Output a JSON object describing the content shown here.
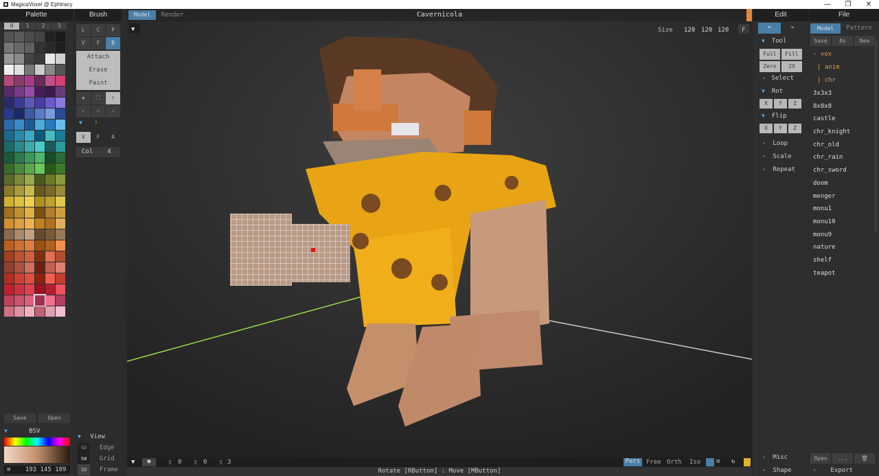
{
  "window": {
    "title": "MagicaVoxel @ Ephtracy",
    "controls": [
      "—",
      "❐",
      "✕"
    ]
  },
  "palette": {
    "header": "Palette",
    "tabs": [
      "0",
      "1",
      "2",
      "3"
    ],
    "colors": [
      "#555",
      "#5a5a5a",
      "#4c4c4c",
      "#444",
      "#222",
      "#1a1a1a",
      "#777",
      "#6a6a6a",
      "#5f5f5f",
      "#333",
      "#2a2a2a",
      "#1e1e1e",
      "#999",
      "#8a8a8a",
      "#444",
      "#3a3a3a",
      "#e8e8e8",
      "#cfcfcf",
      "#f0f0f0",
      "#e0e0e0",
      "#777",
      "#ccc",
      "#888",
      "#555",
      "#b34a7a",
      "#8c3a6a",
      "#a53a8a",
      "#6a2a5a",
      "#c0508a",
      "#d04070",
      "#5a2a6a",
      "#7a3a8a",
      "#9a4aaa",
      "#4a1a5a",
      "#3a1a4a",
      "#6a3a7a",
      "#2a2a6a",
      "#3a3a9a",
      "#5a5aba",
      "#4a3aaa",
      "#6a5aca",
      "#8a7ada",
      "#2a3a8a",
      "#1a2a6a",
      "#3a5aaa",
      "#5a7aca",
      "#7a9ada",
      "#2a4a9a",
      "#2a6aaa",
      "#3a8aca",
      "#1a5a9a",
      "#4aaada",
      "#2a7aba",
      "#6abaea",
      "#1a6a8a",
      "#2a8aaa",
      "#3aaaca",
      "#0a5a7a",
      "#4ababa",
      "#1a7a9a",
      "#1a6a6a",
      "#2a8a8a",
      "#3aaaaa",
      "#4acaca",
      "#1a5a5a",
      "#2a9a9a",
      "#1a5a3a",
      "#2a7a4a",
      "#3a9a5a",
      "#4aba6a",
      "#1a4a2a",
      "#2a6a3a",
      "#3a6a2a",
      "#4a8a3a",
      "#5aaa4a",
      "#6aca5a",
      "#2a5a1a",
      "#3a7a2a",
      "#5a6a2a",
      "#7a8a3a",
      "#9aaa4a",
      "#4a5a1a",
      "#6a7a2a",
      "#8a9a3a",
      "#8a7a2a",
      "#aa9a3a",
      "#caba4a",
      "#6a5a1a",
      "#7a6a2a",
      "#9a8a3a",
      "#d0b030",
      "#e0c040",
      "#f0d050",
      "#b09020",
      "#c0a030",
      "#e0c850",
      "#a07020",
      "#c09030",
      "#e0b040",
      "#805010",
      "#b08030",
      "#d0a040",
      "#d09030",
      "#e0a040",
      "#f0b050",
      "#c08020",
      "#b07020",
      "#e0b060",
      "#8a6a4a",
      "#aa8a6a",
      "#c4a080",
      "#6a4a2a",
      "#7a5a3a",
      "#9a7a5a",
      "#c06020",
      "#d07030",
      "#e08040",
      "#a05010",
      "#b06020",
      "#f09050",
      "#a04020",
      "#c05030",
      "#d06040",
      "#803010",
      "#e07050",
      "#b05030",
      "#904030",
      "#b05040",
      "#d07060",
      "#702010",
      "#c06050",
      "#e08070",
      "#b03020",
      "#d04030",
      "#e05040",
      "#902010",
      "#f06050",
      "#c04030",
      "#c02030",
      "#d03040",
      "#e04050",
      "#a01020",
      "#b02030",
      "#f05060",
      "#c04060",
      "#d05070",
      "#e06080",
      "#a03050",
      "#f07090",
      "#b04060",
      "#d07080",
      "#e090a0",
      "#f0b0c0",
      "#c06070",
      "#e0a0b0",
      "#f0c0d0"
    ],
    "save_label": "Save",
    "open_label": "Open",
    "mode_label": "BSV",
    "rgb_value": "193 145 109"
  },
  "brush": {
    "header": "Brush",
    "shape_row1": [
      "L",
      "C",
      "P"
    ],
    "shape_row2": [
      "V",
      "F",
      "B"
    ],
    "modes": [
      "Attach",
      "Erase",
      "Paint"
    ],
    "axis_row": [
      "V",
      "F",
      "A"
    ],
    "col_label": "Col",
    "col_value": "4"
  },
  "viewport": {
    "tabs": [
      "Model",
      "Render"
    ],
    "title": "Cavernicola",
    "size_label": "Size",
    "size_values": [
      "120",
      "120",
      "120"
    ],
    "size_f": "F",
    "bottom_fields": [
      "0",
      "0",
      "3"
    ],
    "views": [
      "Pers",
      "Free",
      "Orth",
      "Iso"
    ],
    "status_text": "Rotate [RButton] : Move [MButton]"
  },
  "view_panel": {
    "header": "View",
    "rows": [
      [
        "GD",
        "Edge"
      ],
      [
        "SW",
        "Grid"
      ],
      [
        "10",
        "Frame"
      ]
    ]
  },
  "edit": {
    "header": "Edit",
    "tool_label": "Tool",
    "tool_buttons": [
      "Full",
      "Fill",
      "Zero",
      "2X"
    ],
    "select_label": "Select",
    "rot_label": "Rot",
    "flip_label": "Flip",
    "xyz": [
      "X",
      "Y",
      "Z"
    ],
    "loop_label": "Loop",
    "scale_label": "Scale",
    "repeat_label": "Repeat",
    "misc_label": "Misc",
    "shape_label": "Shape"
  },
  "file": {
    "header": "File",
    "tabs": [
      "Model",
      "Pattern"
    ],
    "actions": [
      "Save",
      "As",
      "New"
    ],
    "tree": [
      {
        "label": "- vox",
        "color": "#e0a040"
      },
      {
        "label": "| anim",
        "color": "#e0a040"
      },
      {
        "label": "| chr",
        "color": "#e0a040"
      }
    ],
    "items": [
      "3x3x3",
      "8x8x8",
      "castle",
      "chr_knight",
      "chr_old",
      "chr_rain",
      "chr_sword",
      "doom",
      "menger",
      "monu1",
      "monu10",
      "monu9",
      "nature",
      "shelf",
      "teapot"
    ],
    "open_label": "Open",
    "dots_label": "...",
    "export_label": "Export"
  },
  "colors": {
    "accent": "#4a7fa6",
    "selected_tree": "#e0a040",
    "axis_x": "#9ae04a"
  }
}
